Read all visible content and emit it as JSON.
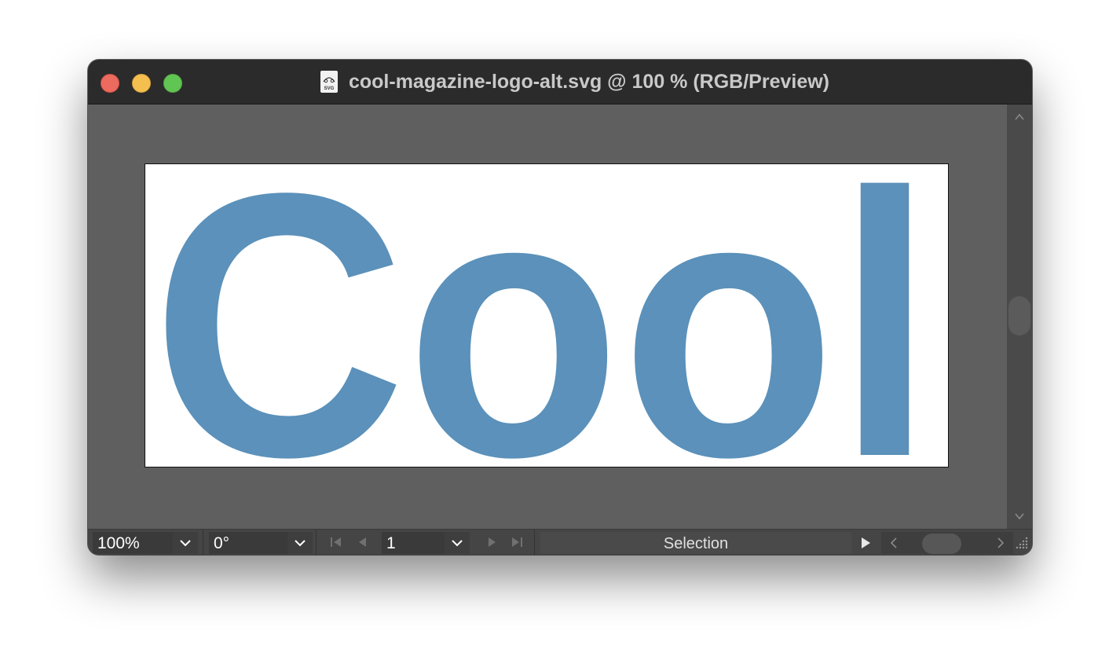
{
  "window": {
    "title": "cool-magazine-logo-alt.svg @ 100 % (RGB/Preview)",
    "file_icon_label": "SVG"
  },
  "artboard": {
    "text": "Cool",
    "text_color": "#5b91ba",
    "background": "#ffffff"
  },
  "statusbar": {
    "zoom": "100%",
    "rotation": "0°",
    "artboard_number": "1",
    "current_tool": "Selection"
  },
  "colors": {
    "titlebar": "#2b2b2b",
    "canvas": "#5f5f5f",
    "close": "#ed6a5e",
    "minimize": "#f5bf4f",
    "maximize": "#61c554"
  },
  "icons": {
    "close": "close-button",
    "minimize": "minimize-button",
    "maximize": "maximize-button",
    "file": "svg-file-icon",
    "first": "first-artboard-icon",
    "prev": "previous-artboard-icon",
    "next": "next-artboard-icon",
    "last": "last-artboard-icon",
    "play": "play-icon",
    "grip": "resize-grip-icon"
  }
}
